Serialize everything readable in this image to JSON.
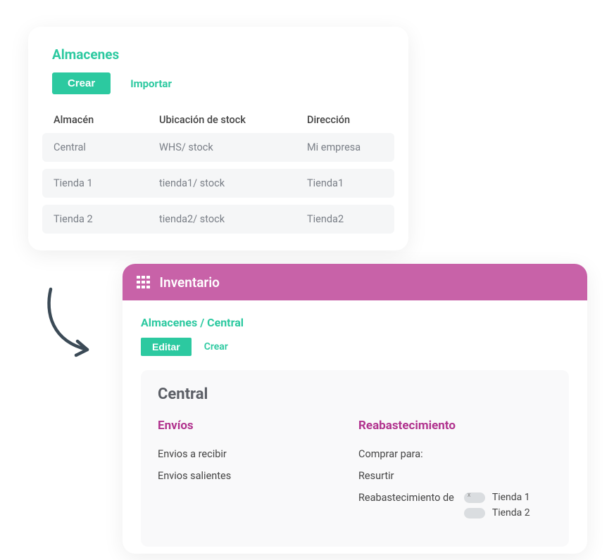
{
  "warehouses": {
    "title": "Almacenes",
    "create": "Crear",
    "import": "Importar",
    "headers": {
      "name": "Almacén",
      "stock": "Ubicación de stock",
      "address": "Dirección"
    },
    "rows": [
      {
        "name": "Central",
        "stock": "WHS/ stock",
        "address": "Mi empresa"
      },
      {
        "name": "Tienda 1",
        "stock": "tienda1/ stock",
        "address": "Tienda1"
      },
      {
        "name": "Tienda 2",
        "stock": "tienda2/ stock",
        "address": "Tienda2"
      }
    ]
  },
  "inventory": {
    "app": "Inventario",
    "breadcrumb": "Almacenes / Central",
    "edit": "Editar",
    "create": "Crear",
    "panel_title": "Central",
    "shipments": {
      "heading": "Envíos",
      "incoming": "Envios a recibir",
      "outgoing": "Envios salientes"
    },
    "resupply": {
      "heading": "Reabastecimiento",
      "buy_for": "Comprar para:",
      "restock": "Resurtir",
      "resupply_from": "Reabastecimiento  de",
      "options": [
        {
          "label": "Tienda 1",
          "on": true
        },
        {
          "label": "Tienda 2",
          "on": false
        }
      ]
    }
  }
}
